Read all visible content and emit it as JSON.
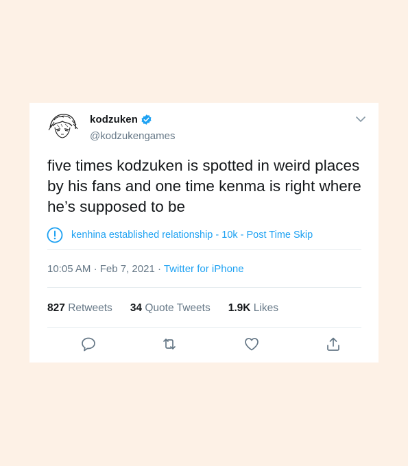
{
  "tweet": {
    "author": {
      "display_name": "kodzuken",
      "handle": "@kodzukengames",
      "verified": true,
      "avatar_icon": "anime-sketch-avatar"
    },
    "text": "five times kodzuken is spotted in weird places by his fans and one time kenma is right where he’s supposed to be",
    "notice": {
      "icon": "exclamation-circle-icon",
      "text": "kenhina established relationship - 10k - Post Time Skip"
    },
    "time": "10:05 AM",
    "separator": "·",
    "date": "Feb 7, 2021",
    "source": "Twitter for iPhone",
    "stats": {
      "retweets_count": "827",
      "retweets_label": "Retweets",
      "quotes_count": "34",
      "quotes_label": "Quote Tweets",
      "likes_count": "1.9K",
      "likes_label": "Likes"
    },
    "actions": [
      "reply-icon",
      "retweet-icon",
      "like-icon",
      "share-icon"
    ]
  },
  "colors": {
    "background": "#fdf1e6",
    "card": "#ffffff",
    "accent": "#1da1f2",
    "text_primary": "#14171a",
    "text_secondary": "#657786",
    "divider": "#e6ecf0"
  }
}
